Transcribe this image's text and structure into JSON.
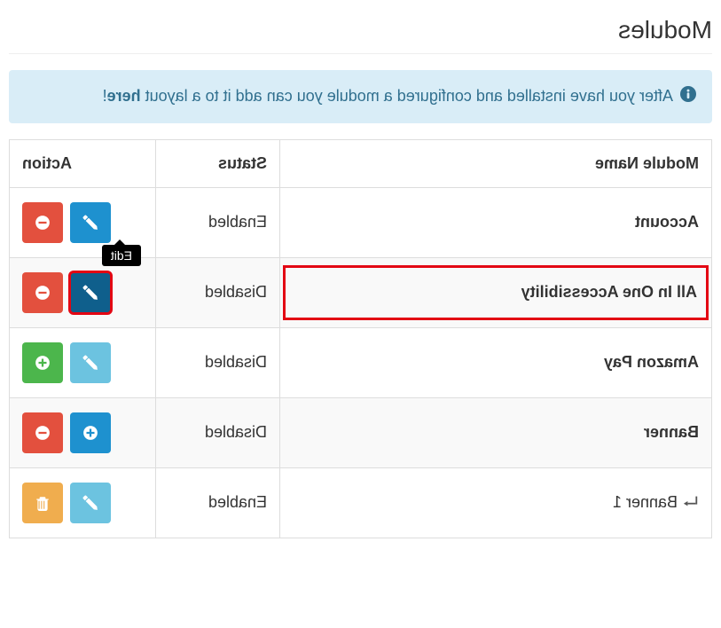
{
  "page": {
    "title": "Modules"
  },
  "info": {
    "text_before": "After you have installed and configured a module you can add it to a layout ",
    "link_text": "here",
    "text_after": "!"
  },
  "table": {
    "headers": {
      "module": "Module Name",
      "status": "Status",
      "action": "Action"
    },
    "tooltip_edit": "Edit",
    "rows": [
      {
        "name": "Account",
        "status": "Enabled",
        "highlighted": false,
        "actions": [
          {
            "type": "edit",
            "variant": "blue"
          },
          {
            "type": "uninstall",
            "variant": "red"
          }
        ],
        "tooltip_on": 0,
        "indent": false
      },
      {
        "name": "All In One Accessibility",
        "status": "Disabled",
        "highlighted": true,
        "actions": [
          {
            "type": "edit",
            "variant": "blue-dark",
            "highlight": true
          },
          {
            "type": "uninstall",
            "variant": "red"
          }
        ],
        "indent": false
      },
      {
        "name": "Amazon Pay",
        "status": "Disabled",
        "highlighted": false,
        "actions": [
          {
            "type": "edit",
            "variant": "blue-lighter"
          },
          {
            "type": "install",
            "variant": "green"
          }
        ],
        "indent": false
      },
      {
        "name": "Banner",
        "status": "Disabled",
        "highlighted": false,
        "actions": [
          {
            "type": "add",
            "variant": "blue"
          },
          {
            "type": "uninstall",
            "variant": "red"
          }
        ],
        "indent": false
      },
      {
        "name": "Banner 1",
        "status": "Enabled",
        "highlighted": false,
        "actions": [
          {
            "type": "edit",
            "variant": "blue-lighter"
          },
          {
            "type": "delete",
            "variant": "orange"
          }
        ],
        "indent": true
      }
    ]
  }
}
